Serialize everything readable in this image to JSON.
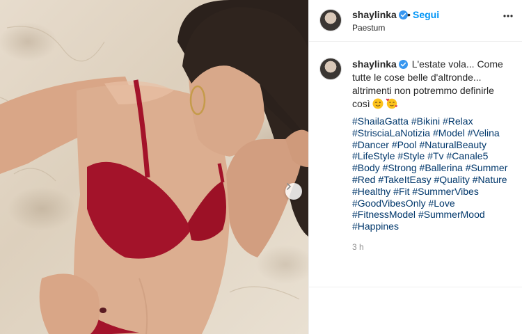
{
  "post": {
    "author": "shaylinka",
    "follow_label": "Segui",
    "separator": "•",
    "location": "Paestum",
    "caption_text": "L'estate vola... Come tutte le cose belle d'altronde... altrimenti non potremmo definirle così",
    "caption_emojis": [
      "wink-emoji",
      "smiling-face-with-hearts-emoji"
    ],
    "hashtags": [
      "#ShailaGatta",
      "#Bikini",
      "#Relax",
      "#StrisciaLaNotizia",
      "#Model",
      "#Velina",
      "#Dancer",
      "#Pool",
      "#NaturalBeauty",
      "#LifeStyle",
      "#Style",
      "#Tv",
      "#Canale5",
      "#Body",
      "#Strong",
      "#Ballerina",
      "#Summer",
      "#Red",
      "#TakeItEasy",
      "#Quality",
      "#Nature",
      "#Healthy",
      "#Fit",
      "#SummerVibes",
      "#GoodVibesOnly",
      "#Love",
      "#FitnessModel",
      "#SummerMood",
      "#Happines"
    ],
    "timestamp": "3 h"
  },
  "icons": {
    "verified": "verified-badge-icon",
    "more": "more-options-icon",
    "next": "chevron-right-icon"
  },
  "colors": {
    "link_blue": "#0095f6",
    "hashtag": "#00376b",
    "verified": "#3897f0",
    "muted": "#8e8e8e",
    "bikini": "#a3132a"
  }
}
